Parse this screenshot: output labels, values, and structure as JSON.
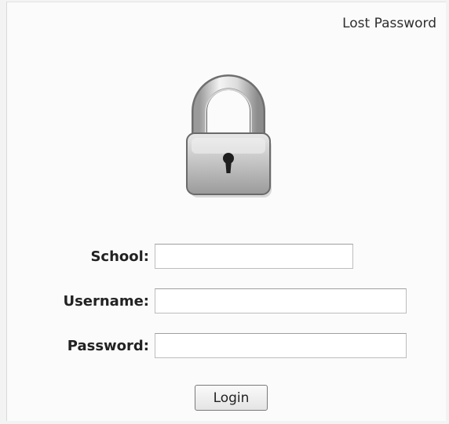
{
  "header": {
    "lost_password_link": "Lost Password"
  },
  "login_form": {
    "icon": "lock-icon",
    "school_label": "School:",
    "school_value": "",
    "username_label": "Username:",
    "username_value": "",
    "password_label": "Password:",
    "password_value": "",
    "login_button": "Login"
  }
}
